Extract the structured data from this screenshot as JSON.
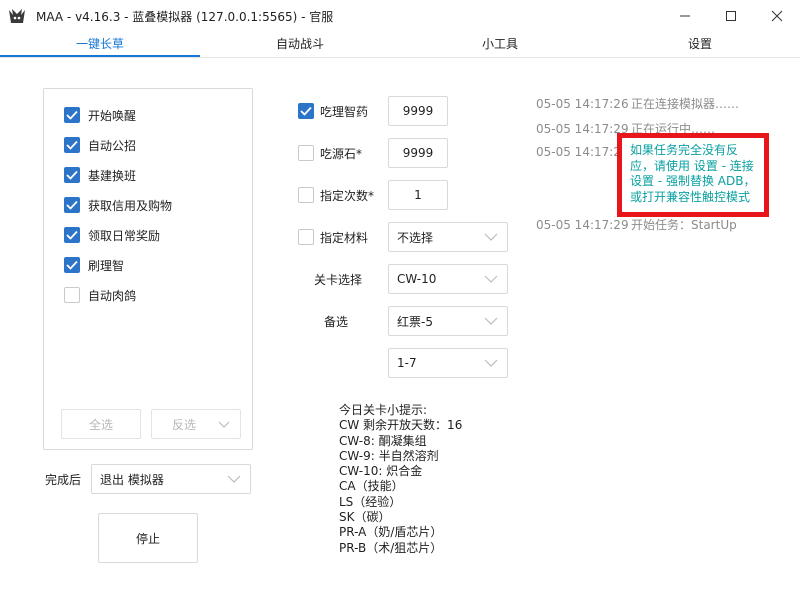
{
  "window": {
    "title": "MAA - v4.16.3 - 蓝叠模拟器 (127.0.0.1:5565) - 官服",
    "controls": {
      "minimize": "–",
      "maximize": "☐",
      "close": "✕"
    }
  },
  "tabs": [
    {
      "label": "一键长草",
      "active": true
    },
    {
      "label": "自动战斗",
      "active": false
    },
    {
      "label": "小工具",
      "active": false
    },
    {
      "label": "设置",
      "active": false
    }
  ],
  "tasks": [
    {
      "label": "开始唤醒",
      "checked": true
    },
    {
      "label": "自动公招",
      "checked": true
    },
    {
      "label": "基建换班",
      "checked": true
    },
    {
      "label": "获取信用及购物",
      "checked": true
    },
    {
      "label": "领取日常奖励",
      "checked": true
    },
    {
      "label": "刷理智",
      "checked": true
    },
    {
      "label": "自动肉鸽",
      "checked": false
    }
  ],
  "task_buttons": {
    "select_all": "全选",
    "invert": "反选"
  },
  "finish": {
    "label": "完成后",
    "value": "退出 模拟器"
  },
  "stop_button": "停止",
  "options": {
    "medicine": {
      "label": "吃理智药",
      "checked": true,
      "value": "9999"
    },
    "stone": {
      "label": "吃源石*",
      "checked": false,
      "value": "9999"
    },
    "times": {
      "label": "指定次数*",
      "checked": false,
      "value": "1"
    },
    "material": {
      "label": "指定材料",
      "checked": false,
      "value": "不选择"
    },
    "stage": {
      "label": "关卡选择",
      "value": "CW-10"
    },
    "backup": {
      "label": "备选",
      "value": "红票-5"
    },
    "backup2": {
      "value": "1-7"
    }
  },
  "tips": {
    "title": "今日关卡小提示:",
    "lines": [
      "CW 剩余开放天数：16",
      "CW-8: 酮凝集组",
      "CW-9: 半自然溶剂",
      "CW-10: 炽合金",
      "CA（技能）",
      "LS（经验）",
      "SK（碳）",
      "PR-A（奶/盾芯片）",
      "PR-B（术/狙芯片）"
    ]
  },
  "log": [
    {
      "time": "05-05  14:17:26",
      "text": "正在连接模拟器……"
    },
    {
      "time": "05-05  14:17:29",
      "text": "正在运行中……"
    },
    {
      "time": "05-05  14:17:29",
      "text": ""
    },
    {
      "time": "05-05  14:17:29",
      "text": "开始任务：StartUp"
    }
  ],
  "warning": "如果任务完全没有反应，请使用 设置 - 连接设置 - 强制替换 ADB，或打开兼容性触控模式",
  "colors": {
    "accent": "#1677d6",
    "checkbox": "#2b74c8",
    "warning_border": "#e8161b",
    "warning_text": "#0aa0a0"
  }
}
